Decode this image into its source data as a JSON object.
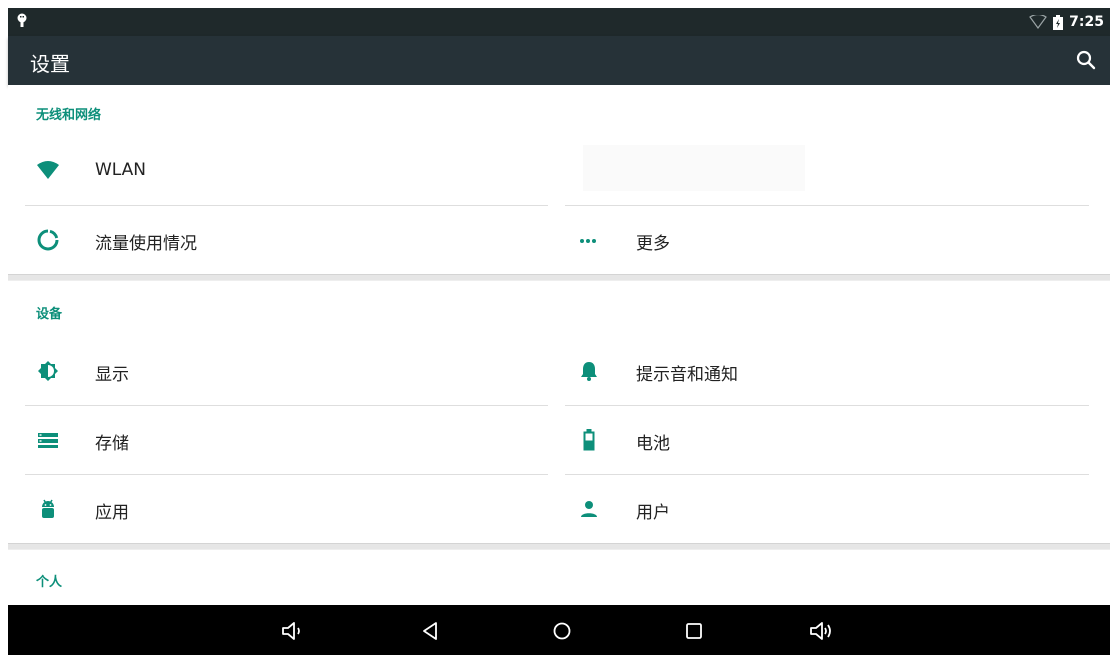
{
  "status_bar": {
    "time": "7:25"
  },
  "app_bar": {
    "title": "设置",
    "search_icon": "search-icon"
  },
  "sections": {
    "wireless": {
      "title": "无线和网络",
      "items": [
        {
          "label": "WLAN",
          "icon": "wifi-icon"
        },
        {
          "label": "流量使用情况",
          "icon": "data-usage-icon"
        },
        {
          "label": "更多",
          "icon": "more-dots-icon"
        }
      ]
    },
    "device": {
      "title": "设备",
      "items": [
        {
          "label": "显示",
          "icon": "brightness-icon"
        },
        {
          "label": "提示音和通知",
          "icon": "bell-icon"
        },
        {
          "label": "存储",
          "icon": "storage-icon"
        },
        {
          "label": "电池",
          "icon": "battery-icon"
        },
        {
          "label": "应用",
          "icon": "android-icon"
        },
        {
          "label": "用户",
          "icon": "user-icon"
        }
      ]
    },
    "personal": {
      "title": "个人"
    }
  },
  "nav_bar": {
    "buttons": [
      "volume-down-icon",
      "back-icon",
      "home-icon",
      "recents-icon",
      "volume-up-icon"
    ]
  },
  "colors": {
    "accent": "#0d8f7a",
    "status_bar": "#1f292b",
    "app_bar": "#263238"
  }
}
